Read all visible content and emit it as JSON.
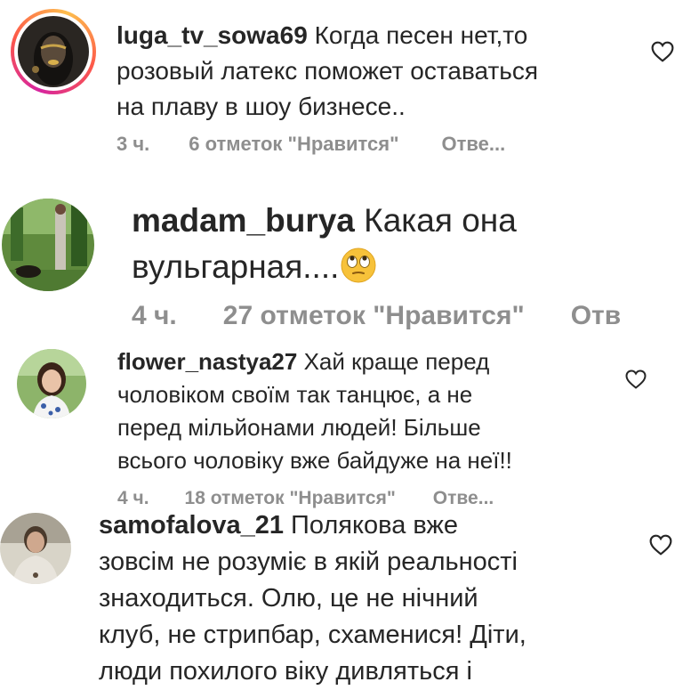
{
  "comments": [
    {
      "username": "luga_tv_sowa69",
      "lines": [
        "Когда песен нет,то",
        "розовый латекс поможет оставаться",
        "на плаву в шоу бизнесе.."
      ],
      "time": "3 ч.",
      "likes": "6 отметок \"Нравится\"",
      "reply": "Отве..."
    },
    {
      "username": "madam_burya",
      "lines": [
        "Какая она",
        "вульгарная...."
      ],
      "emoji": "face-with-rolling-eyes",
      "time": "4 ч.",
      "likes": "27 отметок \"Нравится\"",
      "reply": "Отв"
    },
    {
      "username": "flower_nastya27",
      "lines": [
        "Хай краще перед",
        "чоловіком своїм так танцює, а не",
        "перед мільйонами людей! Більше",
        "всього чоловіку вже байдуже на неї!!"
      ],
      "time": "4 ч.",
      "likes": "18 отметок \"Нравится\"",
      "reply": "Отве..."
    },
    {
      "username": "samofalova_21",
      "lines": [
        "Полякова вже",
        "зовсім не розуміє в якій реальності",
        "знаходиться. Олю, це не нічний",
        "клуб, не стрипбар, схаменися! Діти,",
        "люди похилого віку дивляться і"
      ]
    }
  ],
  "colors": {
    "text": "#262626",
    "meta": "#8e8e8e",
    "story_ring": "#d6249f"
  },
  "icons": {
    "like": "heart-outline-icon"
  }
}
